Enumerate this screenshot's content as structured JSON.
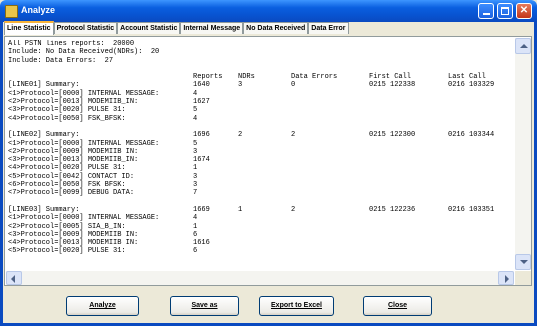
{
  "window": {
    "title": "Analyze"
  },
  "tabs": [
    "Line Statistic",
    "Protocol Statistic",
    "Account Statistic",
    "Internal Message",
    "No Data Received",
    "Data Error"
  ],
  "report": {
    "lines": [
      [
        "All PSTN lines reports:  20000",
        "",
        "",
        "",
        "",
        ""
      ],
      [
        "Include: No Data Received(NDRs):  20",
        "",
        "",
        "",
        "",
        ""
      ],
      [
        "Include: Data Errors:  27",
        "",
        "",
        "",
        "",
        ""
      ],
      [
        "",
        "",
        "",
        "",
        "",
        ""
      ],
      [
        "",
        "Reports",
        "NDRs",
        "Data Errors",
        "First Call",
        "Last Call"
      ],
      [
        "[LINE01] Summary:",
        "1640",
        "3",
        "0",
        "0215 122338",
        "0216 103329"
      ],
      [
        "<1>Protocol=[0000] INTERNAL MESSAGE:",
        "4",
        "",
        "",
        "",
        ""
      ],
      [
        "<2>Protocol=[0013] MODEMIIB_IN:",
        "1627",
        "",
        "",
        "",
        ""
      ],
      [
        "<3>Protocol=[0020] PULSE 31:",
        "5",
        "",
        "",
        "",
        ""
      ],
      [
        "<4>Protocol=[0050] FSK_BFSK:",
        "4",
        "",
        "",
        "",
        ""
      ],
      [
        "",
        "",
        "",
        "",
        "",
        ""
      ],
      [
        "[LINE02] Summary:",
        "1696",
        "2",
        "2",
        "0215 122300",
        "0216 103344"
      ],
      [
        "<1>Protocol=[0000] INTERNAL MESSAGE:",
        "5",
        "",
        "",
        "",
        ""
      ],
      [
        "<2>Protocol=[0009] MODEMIIB IN:",
        "3",
        "",
        "",
        "",
        ""
      ],
      [
        "<3>Protocol=[0013] MODEMIIB_IN:",
        "1674",
        "",
        "",
        "",
        ""
      ],
      [
        "<4>Protocol=[0020] PULSE 31:",
        "1",
        "",
        "",
        "",
        ""
      ],
      [
        "<5>Protocol=[0042] CONTACT ID:",
        "3",
        "",
        "",
        "",
        ""
      ],
      [
        "<6>Protocol=[0050] FSK BFSK:",
        "3",
        "",
        "",
        "",
        ""
      ],
      [
        "<7>Protocol=[0099] DEBUG DATA:",
        "7",
        "",
        "",
        "",
        ""
      ],
      [
        "",
        "",
        "",
        "",
        "",
        ""
      ],
      [
        "[LINE03] Summary:",
        "1669",
        "1",
        "2",
        "0215 122236",
        "0216 103351"
      ],
      [
        "<1>Protocol=[0000] INTERNAL MESSAGE:",
        "4",
        "",
        "",
        "",
        ""
      ],
      [
        "<2>Protocol=[0005] SIA_B_IN:",
        "1",
        "",
        "",
        "",
        ""
      ],
      [
        "<3>Protocol=[0009] MODEMIIB IN:",
        "6",
        "",
        "",
        "",
        ""
      ],
      [
        "<4>Protocol=[0013] MODEMIIB IN:",
        "1616",
        "",
        "",
        "",
        ""
      ],
      [
        "<5>Protocol=[0020] PULSE 31:",
        "6",
        "",
        "",
        "",
        ""
      ]
    ]
  },
  "buttons": {
    "analyze": "Analyze",
    "save_as": "Save as",
    "export": "Export to Excel",
    "close": "Close"
  },
  "icons": {
    "app": "app-icon",
    "minimize": "minimize-icon",
    "maximize": "maximize-icon",
    "close": "close-icon"
  }
}
